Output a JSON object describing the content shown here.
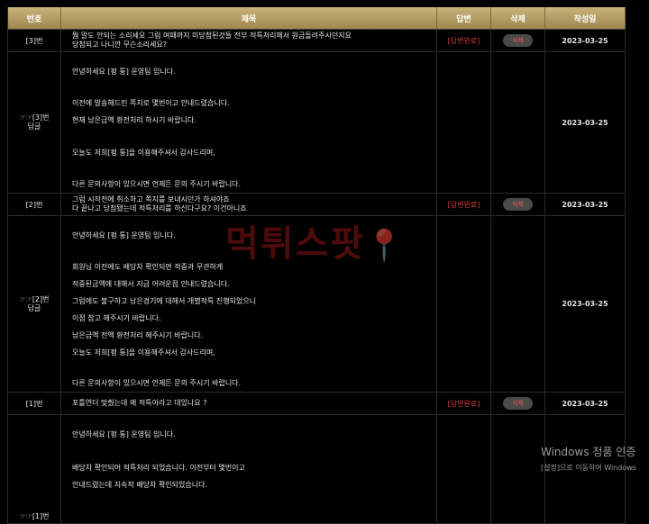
{
  "headers": {
    "no": "번호",
    "title": "제목",
    "answer": "답변",
    "delete": "삭제",
    "date": "작성일"
  },
  "posts": [
    {
      "no": "[3]번",
      "title_lines": [
        "뭠 말도 안되는 소리세요 그럼 여때까지 미당첨된것들 전부 적특처리해서 원금돌려주시던지요",
        "당첨되고 나니깐 무슨소리세요?"
      ],
      "answer": "[답변완료]",
      "delete": "삭제",
      "date": "2023-03-25",
      "reply": {
        "icon": "☞☞",
        "no": "[3]번",
        "label": "답글",
        "date": "2023-03-25",
        "lines": [
          "안녕하세요 [펑 퉁] 운영팀 입니다.",
          "",
          "이전에 발송해드린 쪽지로 몇번이고 안내드렸습니다.",
          "현재 남은금액 환전처리 하시기 바랍니다.",
          "",
          "오늘도 저희[펑 퉁]을 이용해주셔서 감사드리며,",
          "",
          "다른 문의사항이 있으시면 언제든 문의 주시기 바랍니다."
        ]
      }
    },
    {
      "no": "[2]번",
      "title_lines": [
        "그럼 시작전에 취소하고 쪽지를 보내시던가 하셔야죠",
        "다 끝나고 당첨됐는데 적특처리를 하신다구요? 이건아니죠"
      ],
      "answer": "[답변완료]",
      "delete": "삭제",
      "date": "2023-03-25",
      "reply": {
        "icon": "☞☞",
        "no": "[2]번",
        "label": "답글",
        "date": "2023-03-25",
        "lines": [
          "안녕하세요 [펑 퉁] 운영팀 입니다.",
          "",
          "회원님 이전에도 배당차 확인되면 적중과 무관하게",
          "적중된금액에 대해서 지급 어려운점 안내드렸습니다.",
          "그럼에도 불구하고 남은경기에 대해서 개별적특 진행되었으니",
          "이점 참고 해주시기 바랍니다.",
          "남은금액 전액 환전처리 해주시기 바랍니다.",
          "오늘도 저희[펑 퉁]을 이용해주셔서 감사드리며,",
          "",
          "다른 문의사항이 있으시면 언제든 문의 주시기 바랍니다."
        ]
      }
    },
    {
      "no": "[1]번",
      "title_lines": [
        "포틀연더 맞췄는데 왜 적특이라고 대있나요 ?"
      ],
      "answer": "[답변완료]",
      "delete": "삭제",
      "date": "2023-03-25",
      "reply": {
        "icon": "☞☞",
        "no": "[1]번",
        "label": "",
        "date": "",
        "lines": [
          "안녕하세요 [펑 퉁] 운영팀 입니다.",
          "",
          "배당차 확인되어 적특처리 되었습니다. 이전부터 몇번이고",
          "안내드렸는데 지속적 배당차 확인되었습니다."
        ]
      }
    }
  ],
  "watermark": {
    "text": "먹튀스팟",
    "pin": "📍"
  },
  "windows": {
    "line1": "Windows 정품 인증",
    "line2": "[설정]으로 이동하여 Windows"
  }
}
